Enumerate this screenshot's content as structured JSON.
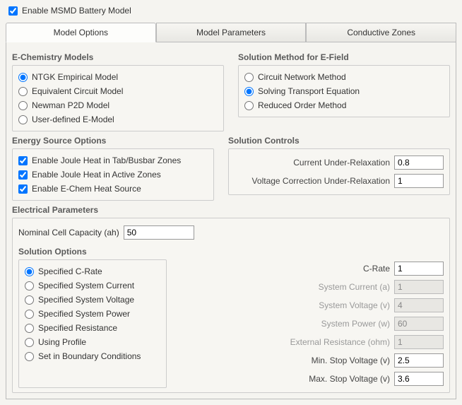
{
  "header": {
    "enable_model_label": "Enable MSMD Battery Model"
  },
  "tabs": {
    "model_options": "Model Options",
    "model_parameters": "Model Parameters",
    "conductive_zones": "Conductive Zones"
  },
  "echem": {
    "title": "E-Chemistry Models",
    "ntgk": "NTGK Empirical Model",
    "ecm": "Equivalent Circuit Model",
    "p2d": "Newman P2D Model",
    "user": "User-defined E-Model"
  },
  "solmethod": {
    "title": "Solution Method for E-Field",
    "circuit": "Circuit Network Method",
    "transport": "Solving Transport Equation",
    "reduced": "Reduced Order Method"
  },
  "energy": {
    "title": "Energy Source Options",
    "tab_busbar": "Enable Joule Heat in Tab/Busbar Zones",
    "active": "Enable Joule Heat in Active Zones",
    "echemheat": "Enable E-Chem Heat Source"
  },
  "solctl": {
    "title": "Solution Controls",
    "current_ur_label": "Current Under-Relaxation",
    "current_ur": "0.8",
    "voltage_ur_label": "Voltage Correction Under-Relaxation",
    "voltage_ur": "1"
  },
  "elec": {
    "title": "Electrical Parameters",
    "nominal_label": "Nominal Cell Capacity (ah)",
    "nominal": "50",
    "solopts_title": "Solution Options",
    "opts": {
      "crate": "Specified C-Rate",
      "syscur": "Specified System Current",
      "sysvolt": "Specified System Voltage",
      "syspow": "Specified System Power",
      "res": "Specified Resistance",
      "profile": "Using Profile",
      "bc": "Set in Boundary Conditions"
    },
    "fields": {
      "crate_label": "C-Rate",
      "crate": "1",
      "syscur_label": "System Current (a)",
      "syscur": "1",
      "sysvolt_label": "System Voltage (v)",
      "sysvolt": "4",
      "syspow_label": "System Power (w)",
      "syspow": "60",
      "extres_label": "External Resistance (ohm)",
      "extres": "1",
      "minstop_label": "Min. Stop Voltage (v)",
      "minstop": "2.5",
      "maxstop_label": "Max. Stop Voltage (v)",
      "maxstop": "3.6"
    }
  }
}
